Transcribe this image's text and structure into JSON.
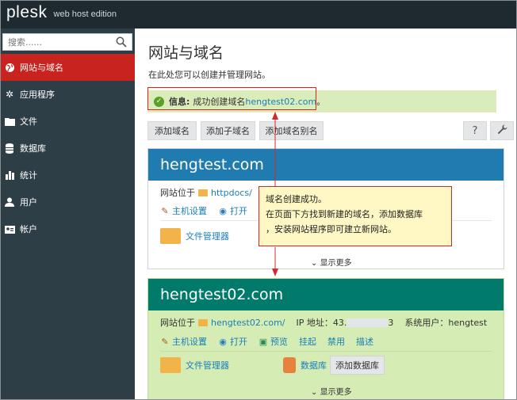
{
  "app": {
    "logo": "plesk",
    "edition": "web host edition"
  },
  "sidebar": {
    "search_placeholder": "搜索......",
    "items": [
      {
        "label": "网站与域名",
        "icon": "globe-icon",
        "active": true
      },
      {
        "label": "应用程序",
        "icon": "gear-icon",
        "active": false
      },
      {
        "label": "文件",
        "icon": "folder-icon",
        "active": false
      },
      {
        "label": "数据库",
        "icon": "database-icon",
        "active": false
      },
      {
        "label": "统计",
        "icon": "bar-chart-icon",
        "active": false
      },
      {
        "label": "用户",
        "icon": "user-icon",
        "active": false
      },
      {
        "label": "帐户",
        "icon": "account-card-icon",
        "active": false
      }
    ]
  },
  "main": {
    "title": "网站与域名",
    "subtitle": "在此处您可以创建并管理网站。",
    "message": {
      "label": "信息:",
      "text": "成功创建域名",
      "domain": "hengtest02.com",
      "suffix": "。"
    },
    "toolbar": {
      "add_domain": "添加域名",
      "add_subdomain": "添加子域名",
      "add_alias": "添加域名别名",
      "help": "?",
      "tools": "wrench-icon"
    }
  },
  "domain1": {
    "name": "hengtest.com",
    "site_at_label": "网站位于",
    "folder_name": "httpdocs/",
    "actions": [
      "主机设置",
      "打开"
    ],
    "file_manager": "文件管理器",
    "show_more": "显示更多"
  },
  "domain2": {
    "name": "hengtest02.com",
    "site_at_label": "网站位于",
    "folder_name": "hengtest02.com/",
    "ip_label": "IP 地址：43.",
    "ip_tail": "3",
    "system_user_label": "系统用户：hengtest",
    "actions": [
      "主机设置",
      "打开",
      "预览",
      "挂起",
      "禁用",
      "描述"
    ],
    "file_manager": "文件管理器",
    "database_label": "数据库",
    "add_database": "添加数据库",
    "show_more": "显示更多"
  },
  "annotation": {
    "line1": "域名创建成功。",
    "line2": "在页面下方找到新建的域名，添加数据库",
    "line3": "，安装网站程序即可建立新网站。"
  },
  "colors": {
    "topbar": "#1f2a30",
    "sidebar": "#2e3e47",
    "active": "#c8231f",
    "card1_head": "#1f7bb0",
    "card2_head": "#007a6a",
    "card2_bg": "#d5ecb4",
    "message_bg": "#d9ecb9",
    "link": "#1a7fb8",
    "annotation_border": "#d62828",
    "callout_bg": "#fff8c4"
  }
}
